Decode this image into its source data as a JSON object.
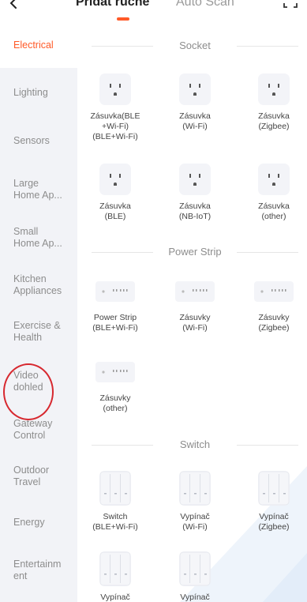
{
  "header": {
    "tab_manual": "Přidat ručně",
    "tab_auto": "Auto Scan",
    "accent_color": "#ff5a28"
  },
  "sidebar": {
    "items": [
      {
        "label": "Electrical"
      },
      {
        "label": "Lighting"
      },
      {
        "label": "Sensors"
      },
      {
        "label": "Large\nHome Ap..."
      },
      {
        "label": "Small\nHome Ap..."
      },
      {
        "label": "Kitchen\nAppliances"
      },
      {
        "label": "Exercise &\nHealth"
      },
      {
        "label": "Video\ndohled"
      },
      {
        "label": "Gateway\nControl"
      },
      {
        "label": "Outdoor\nTravel"
      },
      {
        "label": "Energy"
      },
      {
        "label": "Entertainm\nent"
      }
    ],
    "active_index": 0,
    "highlighted_item": "Video dohled"
  },
  "sections": {
    "socket": {
      "title": "Socket",
      "devices": [
        {
          "label": "Zásuvka(BLE\n+Wi-Fi)\n(BLE+Wi-Fi)",
          "icon": "socket-icon"
        },
        {
          "label": "Zásuvka\n(Wi-Fi)",
          "icon": "socket-icon"
        },
        {
          "label": "Zásuvka\n(Zigbee)",
          "icon": "socket-icon"
        },
        {
          "label": "Zásuvka\n(BLE)",
          "icon": "socket-icon"
        },
        {
          "label": "Zásuvka\n(NB-IoT)",
          "icon": "socket-icon"
        },
        {
          "label": "Zásuvka\n(other)",
          "icon": "socket-icon"
        }
      ]
    },
    "power_strip": {
      "title": "Power Strip",
      "devices": [
        {
          "label": "Power Strip\n(BLE+Wi-Fi)",
          "icon": "power-strip-icon"
        },
        {
          "label": "Zásuvky\n(Wi-Fi)",
          "icon": "power-strip-icon"
        },
        {
          "label": "Zásuvky\n(Zigbee)",
          "icon": "power-strip-icon"
        },
        {
          "label": "Zásuvky\n(other)",
          "icon": "power-strip-icon"
        }
      ]
    },
    "switch": {
      "title": "Switch",
      "devices": [
        {
          "label": "Switch\n(BLE+Wi-Fi)",
          "icon": "wall-switch-icon"
        },
        {
          "label": "Vypínač\n(Wi-Fi)",
          "icon": "wall-switch-icon"
        },
        {
          "label": "Vypínač\n(Zigbee)",
          "icon": "wall-switch-icon"
        },
        {
          "label": "Vypínač",
          "icon": "wall-switch-icon"
        },
        {
          "label": "Vypínač",
          "icon": "wall-switch-icon"
        }
      ]
    }
  }
}
